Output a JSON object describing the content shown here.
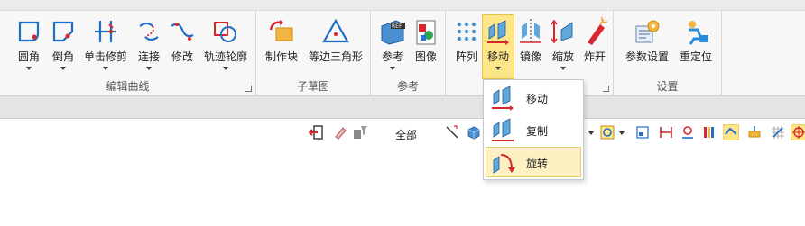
{
  "ribbon": {
    "groups": [
      {
        "label": "编辑曲线"
      },
      {
        "label": "子草图"
      },
      {
        "label": "参考"
      },
      {
        "label": ""
      },
      {
        "label": "设置"
      }
    ],
    "buttons": {
      "fillet": "圆角",
      "chamfer": "倒角",
      "trim": "单击修剪",
      "connect": "连接",
      "modify": "修改",
      "trace": "轨迹轮廓",
      "block": "制作块",
      "triangle": "等边三角形",
      "reference": "参考",
      "image": "图像",
      "array": "阵列",
      "move": "移动",
      "mirror": "镜像",
      "scale": "缩放",
      "explode": "炸开",
      "params": "参数设置",
      "relocate": "重定位"
    }
  },
  "toolbar": {
    "filter_label": "全部"
  },
  "dropdown": {
    "items": [
      {
        "label": "移动"
      },
      {
        "label": "复制"
      },
      {
        "label": "旋转"
      }
    ]
  },
  "colors": {
    "active": "#fde58a",
    "hover": "#fdf0c2",
    "accent_blue": "#1f6fc7",
    "accent_red": "#d8262d"
  }
}
